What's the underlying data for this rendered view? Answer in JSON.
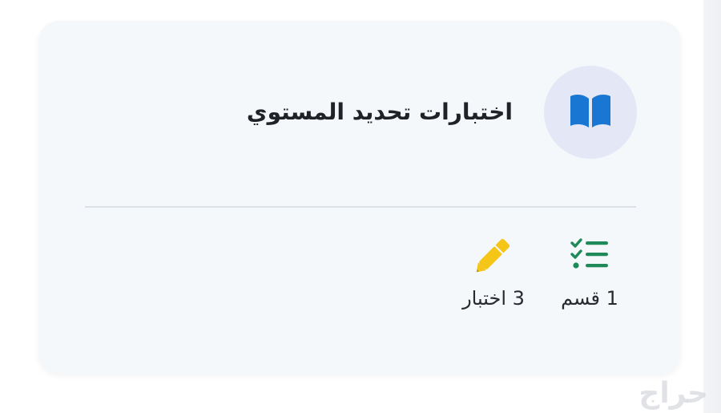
{
  "card": {
    "title": "اختبارات تحديد المستوي",
    "icon": "open-book-icon",
    "icon_color": "#1976d2",
    "icon_bg": "#e4e7f5"
  },
  "stats": {
    "sections": {
      "label": "1 قسم",
      "icon": "checklist-icon",
      "color": "#1e8a5a"
    },
    "tests": {
      "label": "3 اختبار",
      "icon": "pencil-icon",
      "color": "#f5c518"
    }
  },
  "watermark": {
    "text": "حراج"
  }
}
